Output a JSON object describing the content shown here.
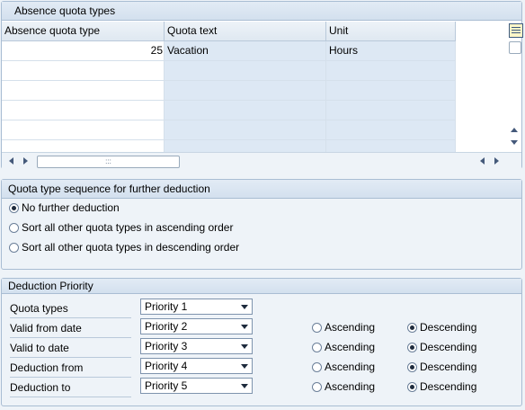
{
  "absence_panel": {
    "title": "Absence quota types",
    "columns": [
      "Absence quota type",
      "Quota text",
      "Unit"
    ],
    "rows": [
      {
        "type": "25",
        "text": "Vacation",
        "unit": "Hours"
      },
      {
        "type": "",
        "text": "",
        "unit": ""
      },
      {
        "type": "",
        "text": "",
        "unit": ""
      },
      {
        "type": "",
        "text": "",
        "unit": ""
      },
      {
        "type": "",
        "text": "",
        "unit": ""
      },
      {
        "type": "",
        "text": "",
        "unit": ""
      }
    ],
    "hscroll_grip": ":::"
  },
  "sequence_panel": {
    "title": "Quota type sequence for further deduction",
    "options": [
      {
        "label": "No further deduction",
        "selected": true
      },
      {
        "label": "Sort all other quota types in ascending order",
        "selected": false
      },
      {
        "label": "Sort all other quota types in descending order",
        "selected": false
      }
    ]
  },
  "priority_panel": {
    "title": "Deduction Priority",
    "rows": [
      {
        "label": "Quota types",
        "priority": "Priority 1"
      },
      {
        "label": "Valid from date",
        "priority": "Priority 2",
        "ascending": "Ascending",
        "descending": "Descending",
        "order": "descending"
      },
      {
        "label": "Valid to date",
        "priority": "Priority 3",
        "ascending": "Ascending",
        "descending": "Descending",
        "order": "descending"
      },
      {
        "label": "Deduction from",
        "priority": "Priority 4",
        "ascending": "Ascending",
        "descending": "Descending",
        "order": "descending"
      },
      {
        "label": "Deduction to",
        "priority": "Priority 5",
        "ascending": "Ascending",
        "descending": "Descending",
        "order": "descending"
      }
    ]
  }
}
